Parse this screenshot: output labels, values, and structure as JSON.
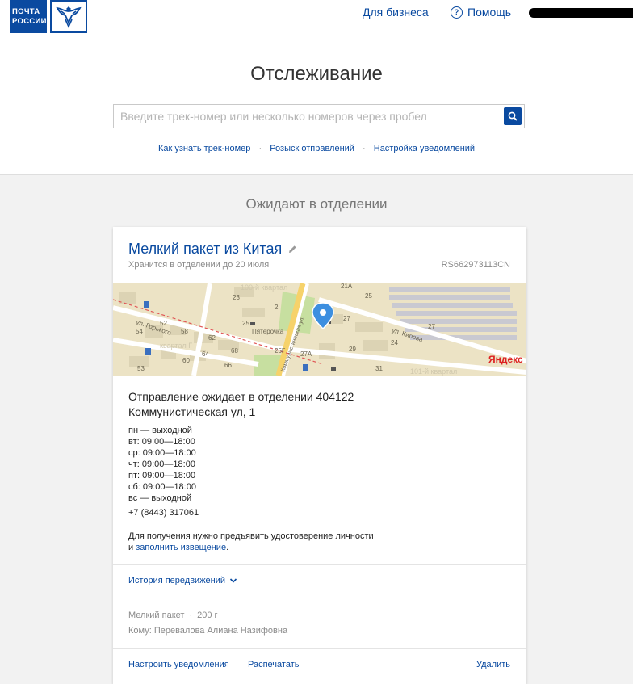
{
  "logo": {
    "line1": "ПОЧТА",
    "line2": "РОССИИ"
  },
  "nav": {
    "business": "Для бизнеса",
    "help": "Помощь"
  },
  "page_title": "Отслеживание",
  "search": {
    "placeholder": "Введите трек-номер или несколько номеров через пробел"
  },
  "links": [
    "Как узнать трек-номер",
    "Розыск отправлений",
    "Настройка уведомлений"
  ],
  "section_title": "Ожидают в отделении",
  "parcel": {
    "title": "Мелкий пакет из Китая",
    "stored_until": "Хранится в отделении до 20 июля",
    "track_number": "RS662973113CN",
    "status_line1": "Отправление ожидает в отделении 404122",
    "status_line2": "Коммунистическая ул, 1",
    "hours": [
      "пн — выходной",
      "вт: 09:00—18:00",
      "ср: 09:00—18:00",
      "чт: 09:00—18:00",
      "пт: 09:00—18:00",
      "сб: 09:00—18:00",
      "вс — выходной"
    ],
    "phone": "+7 (8443) 317061",
    "note_line1": "Для получения нужно предъявить удостоверение личности",
    "note_prefix": "и ",
    "note_link": "заполнить извещение",
    "note_suffix": ".",
    "history_label": "История передвижений",
    "type": "Мелкий пакет",
    "weight": "200 г",
    "recipient": "Кому: Перевалова Алиана Назифовна",
    "actions": {
      "notify": "Настроить уведомления",
      "print": "Распечатать",
      "delete": "Удалить"
    }
  },
  "map": {
    "labels": {
      "kvartal100": "100-й квартал",
      "gorkogo": "ул. Горького",
      "kvartalG": "квартал Г",
      "kirova": "ул. Кирова",
      "kommunist": "Коммунистическая ул.",
      "kvartal101": "101-й квартал",
      "pyaterochka": "Пятёрочка",
      "n21a": "21А",
      "n23": "23",
      "n25a": "25",
      "n25b": "25",
      "n2": "2",
      "n27": "27",
      "n27b": "27",
      "n52": "52",
      "n58": "58",
      "n54": "54",
      "n62": "62",
      "n64": "64",
      "n68": "68",
      "n60": "60",
      "n66": "66",
      "n53": "53",
      "n25g": "25Г",
      "n27a": "27А",
      "n29": "29",
      "n24": "24",
      "n31": "31"
    },
    "brand": "Яндекс"
  },
  "colors": {
    "brand": "#0a4aa0"
  }
}
